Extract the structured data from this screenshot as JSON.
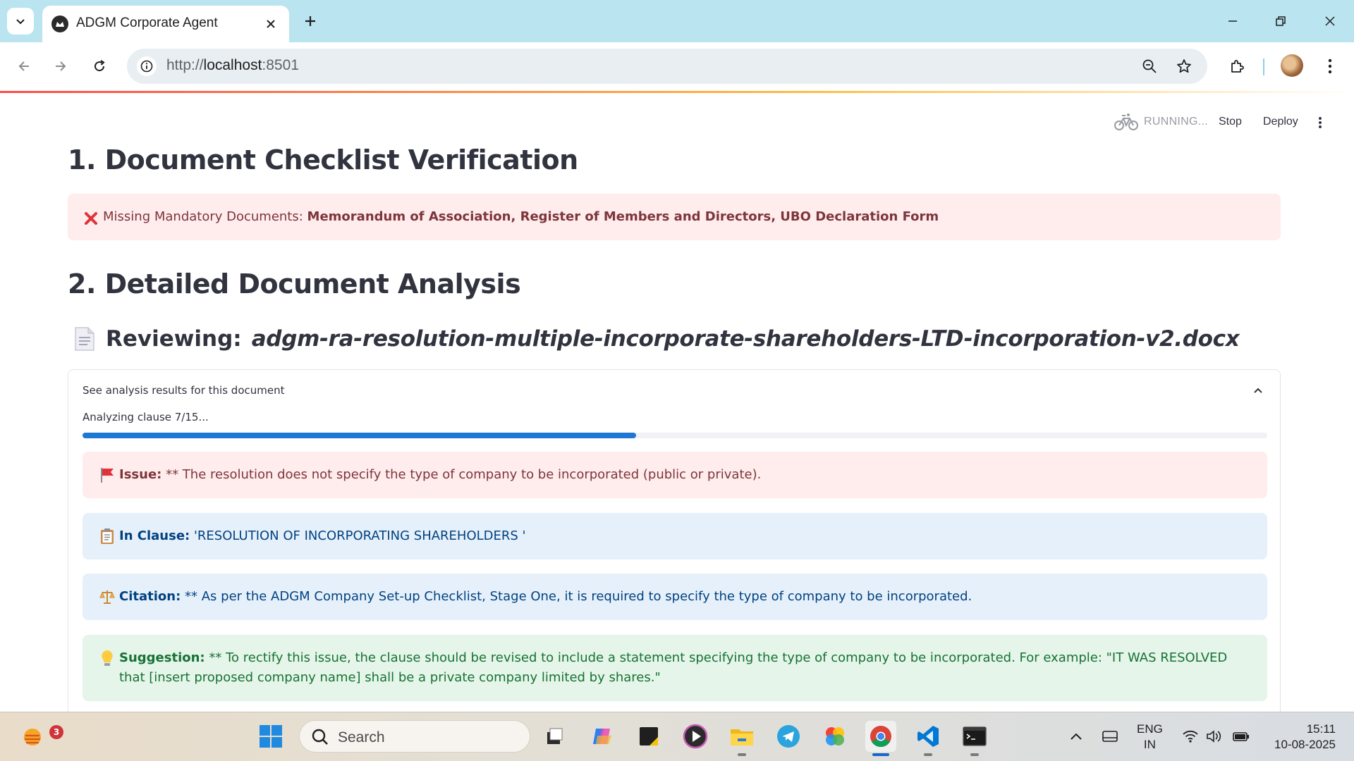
{
  "browser": {
    "tab_title": "ADGM Corporate Agent",
    "url_scheme": "http://",
    "url_host": "localhost",
    "url_port": ":8501"
  },
  "streamlit_header": {
    "status": "RUNNING...",
    "stop_label": "Stop",
    "deploy_label": "Deploy"
  },
  "checklist": {
    "heading": "1. Document Checklist Verification",
    "missing_label": "Missing Mandatory Documents:",
    "missing_docs": "Memorandum of Association, Register of Members and Directors, UBO Declaration Form"
  },
  "analysis": {
    "heading": "2. Detailed Document Analysis",
    "reviewing_label": "Reviewing:",
    "filename": "adgm-ra-resolution-multiple-incorporate-shareholders-LTD-incorporation-v2.docx",
    "expander_title": "See analysis results for this document",
    "progress_label": "Analyzing clause 7/15...",
    "progress_fraction": 0.467,
    "issue_label": "Issue:",
    "issue_text": " ** The resolution does not specify the type of company to be incorporated (public or private).",
    "clause_label": "In Clause:",
    "clause_text": " 'RESOLUTION OF INCORPORATING SHAREHOLDERS '",
    "citation_label": "Citation:",
    "citation_text": " ** As per the ADGM Company Set-up Checklist, Stage One, it is required to specify the type of company to be incorporated.",
    "suggestion_label": "Suggestion:",
    "suggestion_text": " ** To rectify this issue, the clause should be revised to include a statement specifying the type of company to be incorporated. For example: \"IT WAS RESOLVED that [insert proposed company name] shall be a private company limited by shares.\""
  },
  "taskbar": {
    "weather_badge": "3",
    "search_placeholder": "Search",
    "lang_line1": "ENG",
    "lang_line2": "IN",
    "time": "15:11",
    "date": "10-08-2025"
  },
  "colors": {
    "tabbar_bg": "#b9e4f0",
    "error_bg": "#ffecec",
    "info_bg": "#e6f0fb",
    "success_bg": "#e5f5ea",
    "progress": "#1f77d4"
  }
}
